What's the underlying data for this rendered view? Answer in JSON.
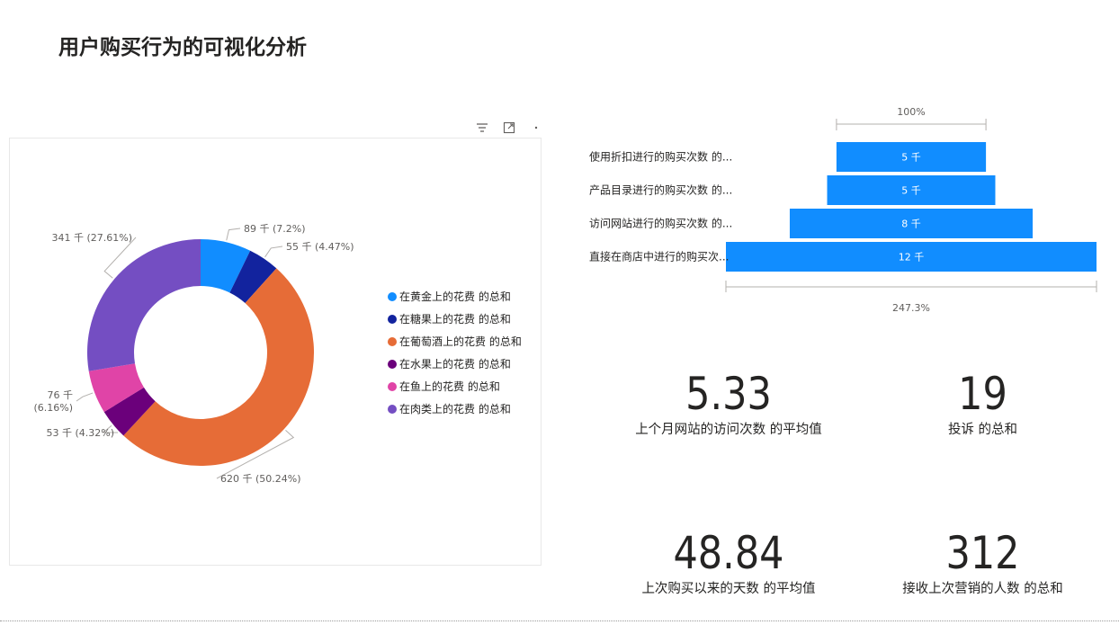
{
  "page": {
    "title": "用户购买行为的可视化分析"
  },
  "colors": {
    "blue": "#118DFF",
    "dark_blue": "#12239E",
    "orange": "#E66C37",
    "purple_dark": "#6B007B",
    "pink": "#E044A7",
    "purple": "#744EC2",
    "funnel_bar": "#118DFF"
  },
  "toolbar": {
    "icons": [
      "filter-icon",
      "focus-mode-icon",
      "more-options-icon"
    ]
  },
  "chart_data": [
    {
      "type": "pie",
      "variant": "donut",
      "categories": [
        "在黄金上的花费 的总和",
        "在糖果上的花费 的总和",
        "在葡萄酒上的花费 的总和",
        "在水果上的花费 的总和",
        "在鱼上的花费 的总和",
        "在肉类上的花费 的总和"
      ],
      "values": [
        89,
        55,
        620,
        53,
        76,
        341
      ],
      "percents": [
        7.2,
        4.47,
        50.24,
        4.32,
        6.16,
        27.61
      ],
      "data_labels": [
        "89 千 (7.2%)",
        "55 千 (4.47%)",
        "620 千 (50.24%)",
        "53 千 (4.32%)",
        "76 千 (6.16%)",
        "341 千 (27.61%)"
      ],
      "colors": [
        "#118DFF",
        "#12239E",
        "#E66C37",
        "#6B007B",
        "#E044A7",
        "#744EC2"
      ],
      "legend_position": "right"
    },
    {
      "type": "bar",
      "variant": "funnel",
      "categories": [
        "使用折扣进行的购买次数 的...",
        "产品目录进行的购买次数 的...",
        "访问网站进行的购买次数 的...",
        "直接在商店中进行的购买次..."
      ],
      "values": [
        4.8,
        5.4,
        7.8,
        11.9
      ],
      "value_labels": [
        "5 千",
        "5 千",
        "8 千",
        "12 千"
      ],
      "top_percent_label": "100%",
      "bottom_percent_label": "247.3%"
    }
  ],
  "cards": [
    {
      "value": "5.33",
      "label": "上个月网站的访问次数 的平均值"
    },
    {
      "value": "19",
      "label": "投诉 的总和"
    },
    {
      "value": "48.84",
      "label": "上次购买以来的天数 的平均值"
    },
    {
      "value": "312",
      "label": "接收上次营销的人数 的总和"
    }
  ]
}
